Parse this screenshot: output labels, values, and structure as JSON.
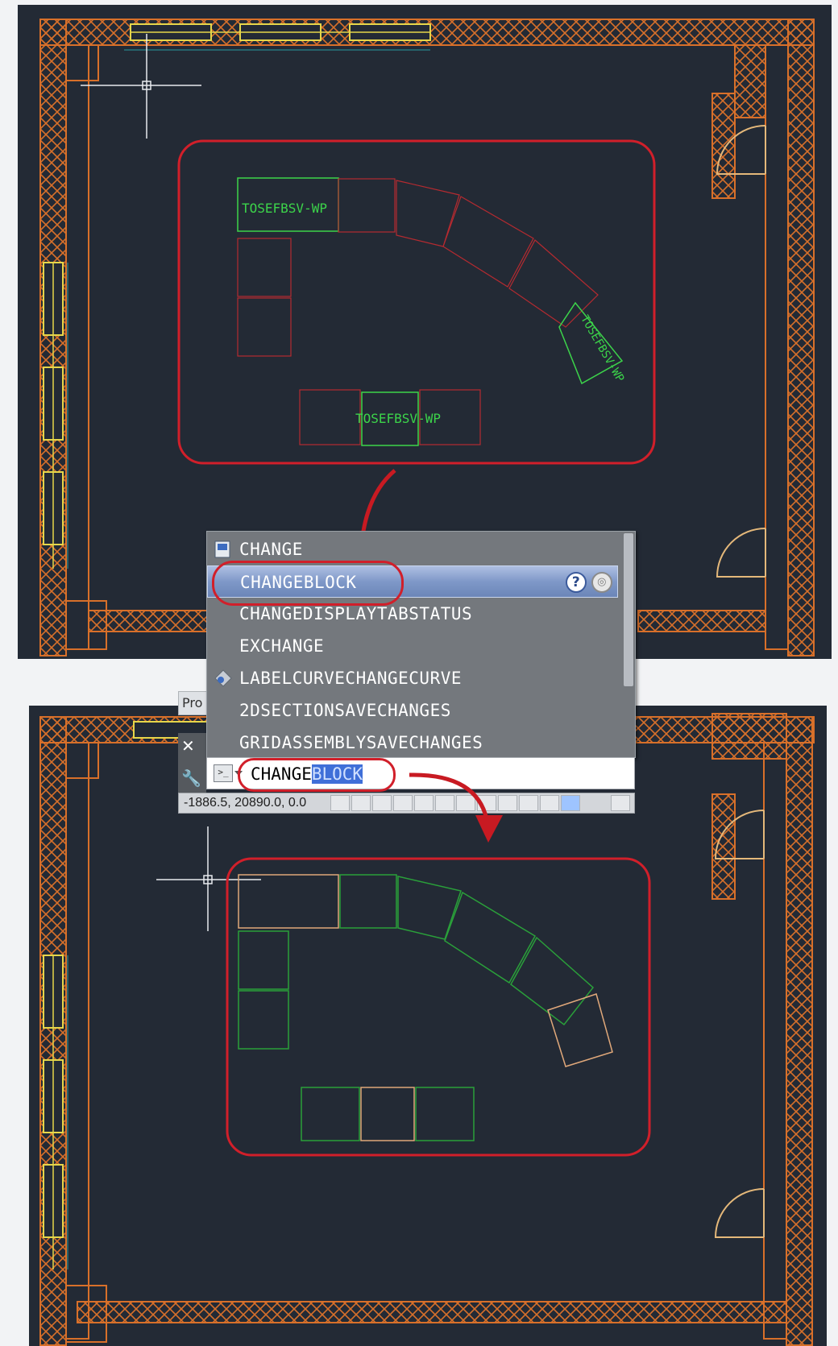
{
  "autocomplete": {
    "items": [
      {
        "label": "CHANGE",
        "icon": "command-icon"
      },
      {
        "label": "CHANGEBLOCK",
        "icon": "none",
        "selected": true
      },
      {
        "label": "CHANGEDISPLAYTABSTATUS",
        "icon": "none"
      },
      {
        "label": "EXCHANGE",
        "icon": "none"
      },
      {
        "label": "LABELCURVECHANGECURVE",
        "icon": "gear-diamond-icon"
      },
      {
        "label": "2DSECTIONSAVECHANGES",
        "icon": "none"
      },
      {
        "label": "GRIDASSEMBLYSAVECHANGES",
        "icon": "none"
      }
    ],
    "help_glyph": "?",
    "web_glyph": "◎"
  },
  "command_line": {
    "typed": "CHANGE",
    "completion": "BLOCK",
    "prompt_glyph": ">_"
  },
  "side_panel": {
    "properties_stub": "Pro",
    "close_glyph": "✕",
    "customize_glyph": "🔧"
  },
  "status_bar": {
    "coordinates": "-1886.5, 20890.0, 0.0"
  },
  "drawing_top": {
    "labels": [
      "TOSEFBSV-WP",
      "TOSEFBSV-WP",
      "TOSEFBSV-WP"
    ]
  },
  "colors": {
    "canvas_bg": "#232a35",
    "wall_orange": "#d8702a",
    "window_yellow": "#e6d64a",
    "highlight_red": "#d11f2a",
    "block_green": "#2aa03a",
    "block_red": "#b52a30",
    "bright_green": "#3cd44a",
    "cyan_line": "#2a9aa0"
  }
}
